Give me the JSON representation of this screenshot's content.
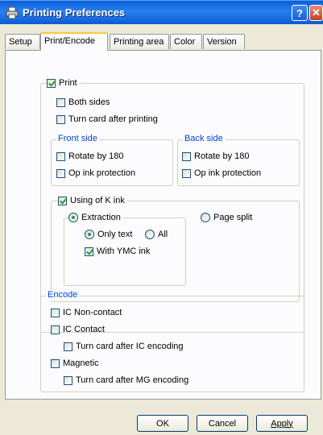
{
  "window": {
    "title": "Printing Preferences",
    "icon": "printer-icon",
    "help_label": "?",
    "close_label": "✕"
  },
  "tabs": [
    {
      "label": "Setup"
    },
    {
      "label": "Print/Encode",
      "active": true
    },
    {
      "label": "Printing area"
    },
    {
      "label": "Color"
    },
    {
      "label": "Version"
    }
  ],
  "print": {
    "label": "Print",
    "checked": true,
    "both_sides": {
      "label": "Both sides",
      "checked": false
    },
    "turn_after": {
      "label": "Turn card after printing",
      "checked": false
    },
    "front": {
      "title": "Front side",
      "rotate": {
        "label": "Rotate by 180",
        "checked": false
      },
      "op_ink": {
        "label": "Op ink protection",
        "checked": false
      }
    },
    "back": {
      "title": "Back side",
      "rotate": {
        "label": "Rotate by 180",
        "checked": false
      },
      "op_ink": {
        "label": "Op ink protection",
        "checked": false
      }
    },
    "k_ink": {
      "label": "Using of K ink",
      "checked": true,
      "extraction": {
        "label": "Extraction",
        "selected": true
      },
      "page_split": {
        "label": "Page split",
        "selected": false
      },
      "only_text": {
        "label": "Only text",
        "selected": true
      },
      "all": {
        "label": "All",
        "selected": false
      },
      "with_ymc": {
        "label": "With YMC ink",
        "checked": true
      }
    }
  },
  "encode": {
    "title": "Encode",
    "ic_noncontact": {
      "label": "IC Non-contact",
      "checked": false
    },
    "ic_contact": {
      "label": "IC Contact",
      "checked": false
    },
    "turn_ic": {
      "label": "Turn card after IC encoding",
      "checked": false
    },
    "magnetic": {
      "label": "Magnetic",
      "checked": false
    },
    "turn_mg": {
      "label": "Turn card after MG encoding",
      "checked": false
    }
  },
  "buttons": {
    "ok": "OK",
    "cancel": "Cancel",
    "apply": "Apply"
  },
  "colors": {
    "accent": "#0046d5",
    "titlebar": "#0a5fd8",
    "check": "#21a121"
  }
}
